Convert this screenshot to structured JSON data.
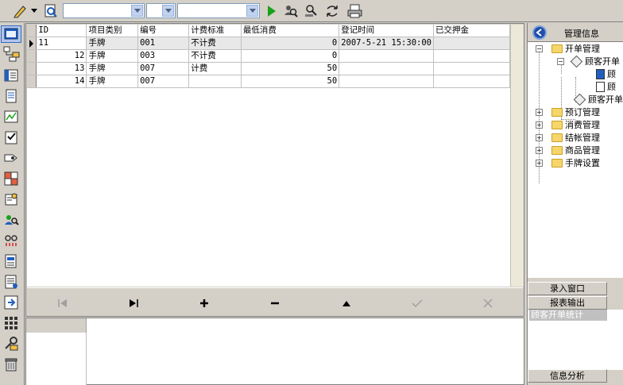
{
  "toolbar": {
    "combo1_value": "",
    "combo2_value": "",
    "combo3_value": ""
  },
  "grid": {
    "columns": [
      "ID",
      "项目类别",
      "编号",
      "计费标准",
      "最低消费",
      "登记时间",
      "已交押金"
    ],
    "rows": [
      {
        "id": "11",
        "type": "手牌",
        "code": "001",
        "billing": "不计费",
        "min": "0",
        "time": "2007-5-21 15:30:00",
        "deposit": ""
      },
      {
        "id": "12",
        "type": "手牌",
        "code": "003",
        "billing": "不计费",
        "min": "0",
        "time": "",
        "deposit": ""
      },
      {
        "id": "13",
        "type": "手牌",
        "code": "007",
        "billing": "计费",
        "min": "50",
        "time": "",
        "deposit": ""
      },
      {
        "id": "14",
        "type": "手牌",
        "code": "007",
        "billing": "",
        "min": "50",
        "time": "",
        "deposit": ""
      }
    ]
  },
  "right_panel": {
    "title": "管理信息",
    "tree": {
      "root": "开单管理",
      "child": "顾客开单",
      "leaf1": "顾",
      "leaf2": "顾",
      "child2": "顾客开单",
      "others": [
        "预订管理",
        "消费管理",
        "结帐管理",
        "商品管理",
        "手牌设置"
      ]
    },
    "buttons": {
      "entry": "录入窗口",
      "report": "报表输出",
      "analysis": "信息分析"
    },
    "report_item": "顾客开单统计"
  }
}
